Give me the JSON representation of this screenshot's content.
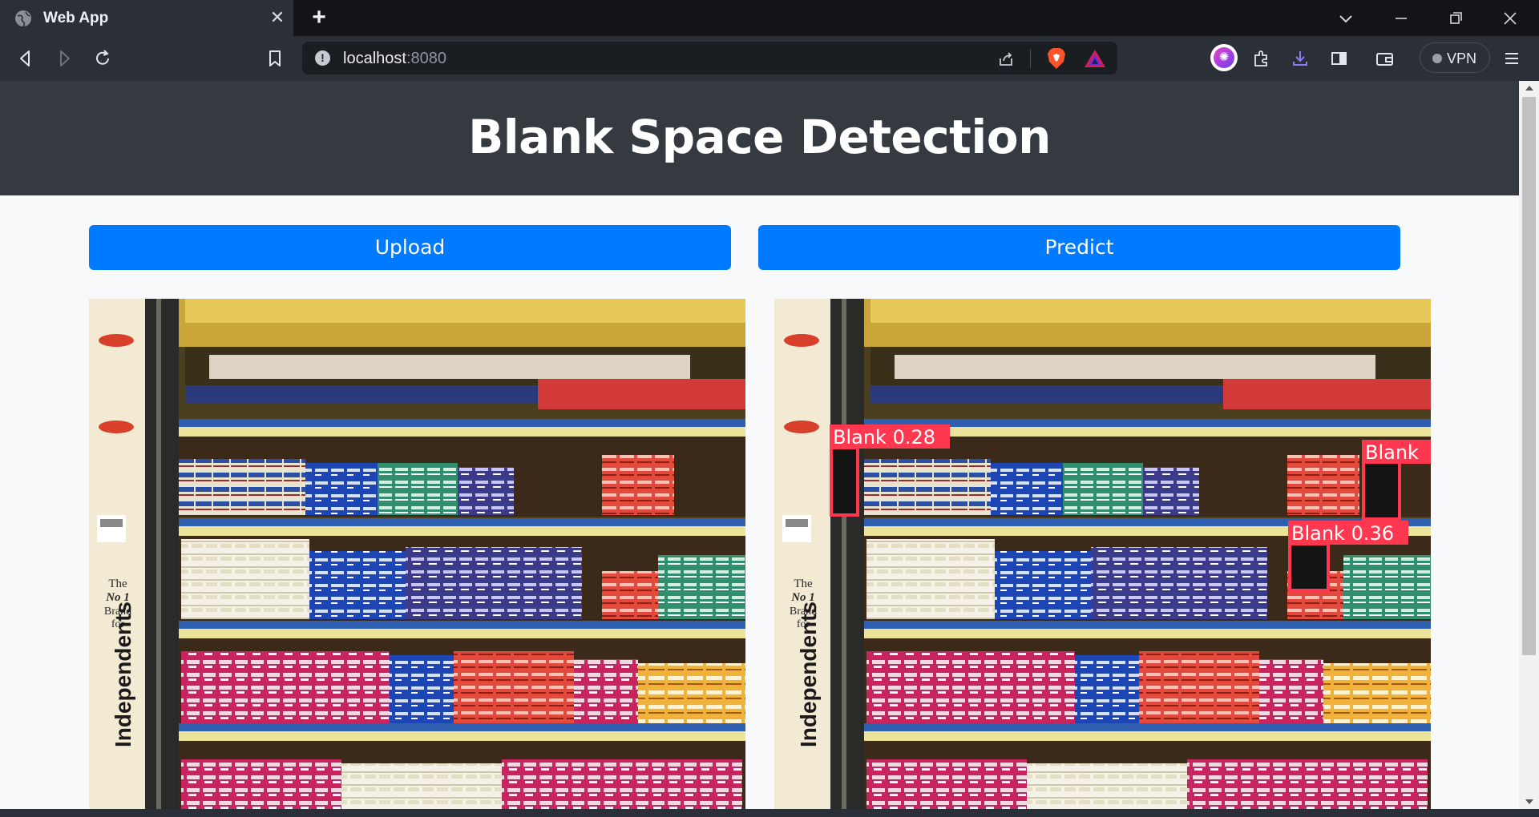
{
  "browser": {
    "tab_title": "Web App",
    "url_host": "localhost",
    "url_port": ":8080",
    "vpn_label": "VPN",
    "icons": [
      "globe-icon",
      "close-icon",
      "plus-icon",
      "chevron-down-icon",
      "minimize-icon",
      "restore-icon",
      "window-close-icon",
      "back-icon",
      "forward-icon",
      "reload-icon",
      "bookmark-icon",
      "info-icon",
      "share-icon",
      "brave-shields-icon",
      "brave-rewards-icon",
      "leo-ai-icon",
      "extensions-icon",
      "download-icon",
      "sidebar-icon",
      "wallet-icon",
      "menu-icon"
    ]
  },
  "page": {
    "title": "Blank Space Detection",
    "upload_label": "Upload",
    "predict_label": "Predict",
    "header_bg": "#343a40",
    "button_bg": "#007bff"
  },
  "detections": [
    {
      "label": "Blank 0.28"
    },
    {
      "label": "Blank"
    },
    {
      "label": "Blank 0.36"
    }
  ],
  "shelf_sign": {
    "line1": "The",
    "line2": "No 1",
    "line3": "Brand",
    "line4": "for",
    "vertical": "Independents"
  }
}
